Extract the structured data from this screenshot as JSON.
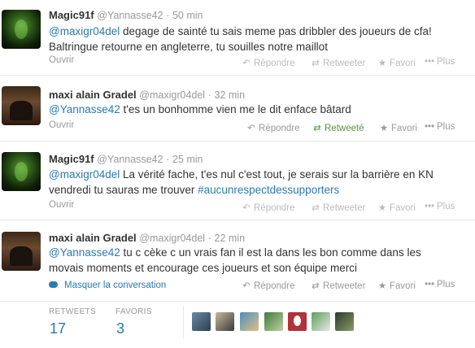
{
  "tweets": [
    {
      "name": "Magic91f",
      "handle": "@Yannasse42",
      "time": "50 min",
      "mention": "@maxigr04del",
      "text1": " degage de sainté tu sais meme pas dribbler des joueurs de cfa!",
      "text2": "Baltringue retourne en angleterre, tu souilles notre maillot",
      "open": "Ouvrir",
      "reply": "Répondre",
      "retweet": "Retweeter",
      "favorite": "Favori",
      "more": "Plus"
    },
    {
      "name": "maxi alain Gradel",
      "handle": "@maxigr04del",
      "time": "32 min",
      "mention": "@Yannasse42",
      "text1": " t'es un bonhomme vien me le dit enface bâtard",
      "open": "Ouvrir",
      "reply": "Répondre",
      "retweet": "Retweeté",
      "favorite": "Favori",
      "more": "Plus"
    },
    {
      "name": "Magic91f",
      "handle": "@Yannasse42",
      "time": "25 min",
      "mention": "@maxigr04del",
      "text1": " La vérité fache, t'es nul c'est tout, je serais sur la barrière en KN",
      "text2": "vendredi tu sauras me trouver ",
      "hashtag": "#aucunrespectdessupporters",
      "open": "Ouvrir",
      "reply": "Répondre",
      "retweet": "Retweeter",
      "favorite": "Favori",
      "more": "Plus"
    },
    {
      "name": "maxi alain Gradel",
      "handle": "@maxigr04del",
      "time": "22 min",
      "mention": "@Yannasse42",
      "text1": " tu c cèke c un vrais fan il est la dans les bon comme dans les",
      "text2": "movais moments et encourage ces joueurs et son équipe merci",
      "hide_conversation": "Masquer la conversation",
      "reply": "Répondre",
      "retweet": "Retweeter",
      "favorite": "Favori",
      "more": "Plus"
    }
  ],
  "stats": {
    "retweets_label": "RETWEETS",
    "retweets_value": "17",
    "favorites_label": "FAVORIS",
    "favorites_value": "3"
  },
  "colors": {
    "link": "#2a7ab0",
    "retweeted": "#5c913b",
    "muted": "#999999"
  },
  "icons": [
    "reply-icon",
    "retweet-icon",
    "star-icon",
    "ellipsis-icon",
    "conversation-bubble-icon"
  ]
}
